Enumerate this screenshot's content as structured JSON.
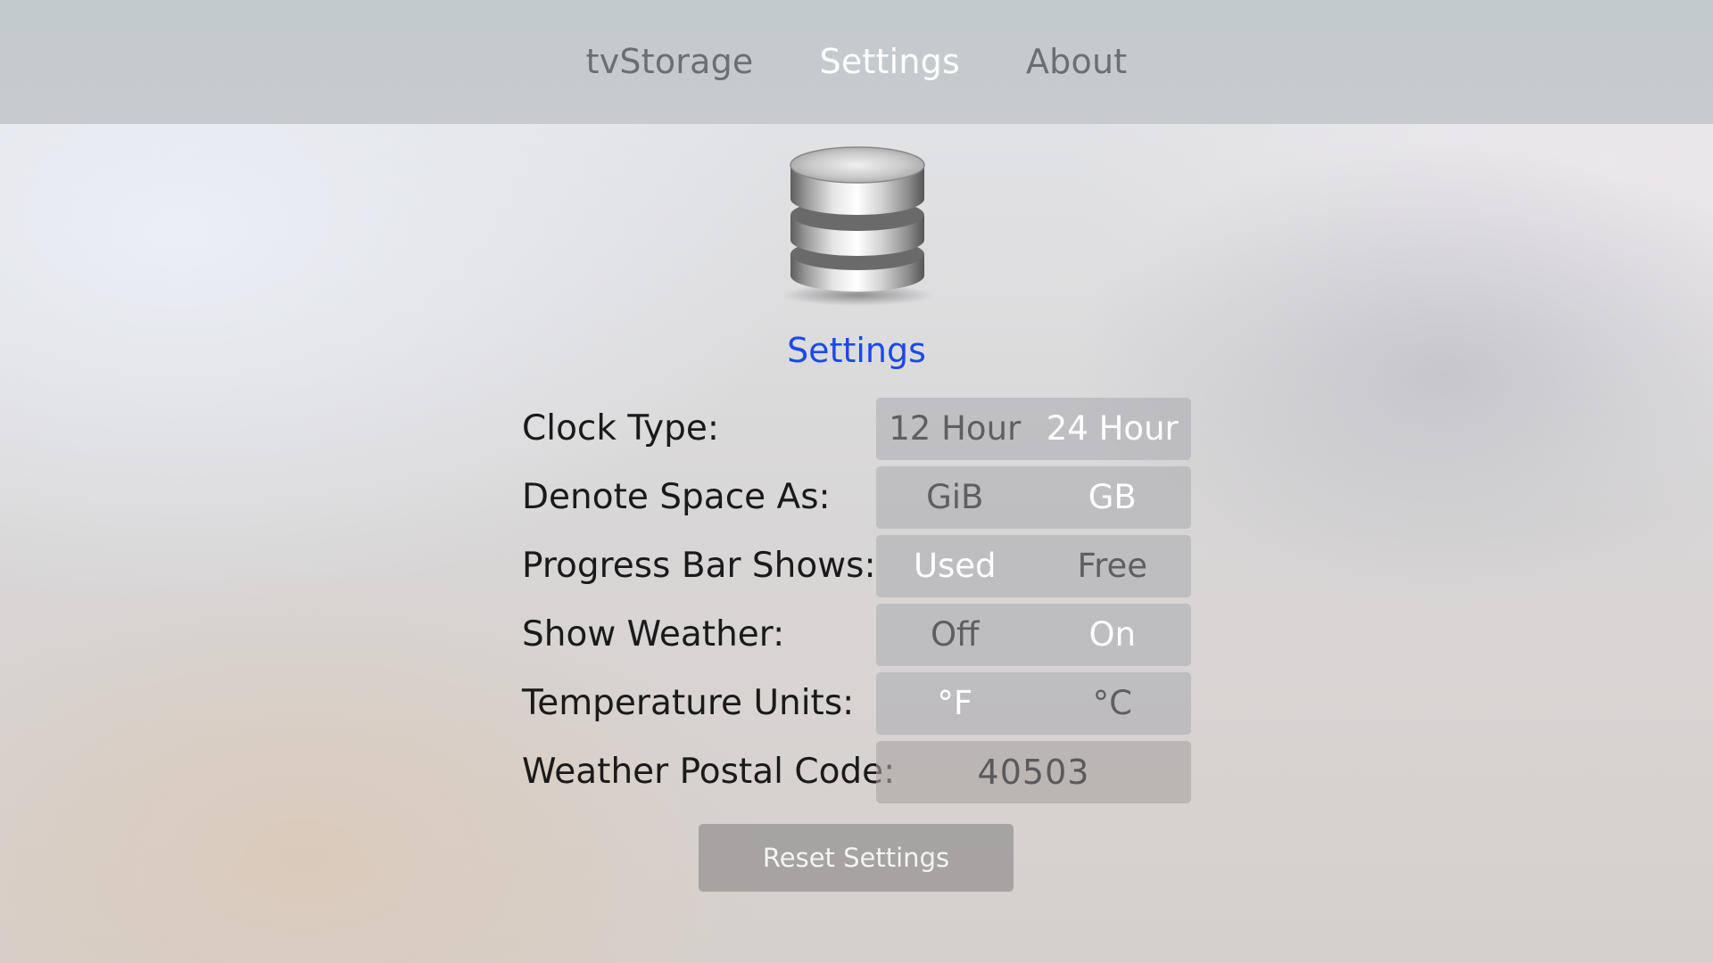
{
  "nav": {
    "tabs": [
      {
        "label": "tvStorage",
        "selected": false
      },
      {
        "label": "Settings",
        "selected": true
      },
      {
        "label": "About",
        "selected": false
      }
    ]
  },
  "page": {
    "icon": "database-icon",
    "title": "Settings"
  },
  "settings": {
    "clock_type": {
      "label": "Clock Type:",
      "options": [
        "12 Hour",
        "24 Hour"
      ],
      "selected": "24 Hour"
    },
    "denote_space": {
      "label": "Denote Space As:",
      "options": [
        "GiB",
        "GB"
      ],
      "selected": "GB"
    },
    "progress_bar": {
      "label": "Progress Bar Shows:",
      "options": [
        "Used",
        "Free"
      ],
      "selected": "Used"
    },
    "show_weather": {
      "label": "Show Weather:",
      "options": [
        "Off",
        "On"
      ],
      "selected": "On"
    },
    "temperature_units": {
      "label": "Temperature Units:",
      "options": [
        "°F",
        "°C"
      ],
      "selected": "°F"
    },
    "postal_code": {
      "label": "Weather Postal Code:",
      "value": "40503"
    }
  },
  "actions": {
    "reset_label": "Reset Settings"
  },
  "colors": {
    "accent": "#1d49e8",
    "selected_text": "#ffffff",
    "unselected_text": "#5e5f62"
  }
}
